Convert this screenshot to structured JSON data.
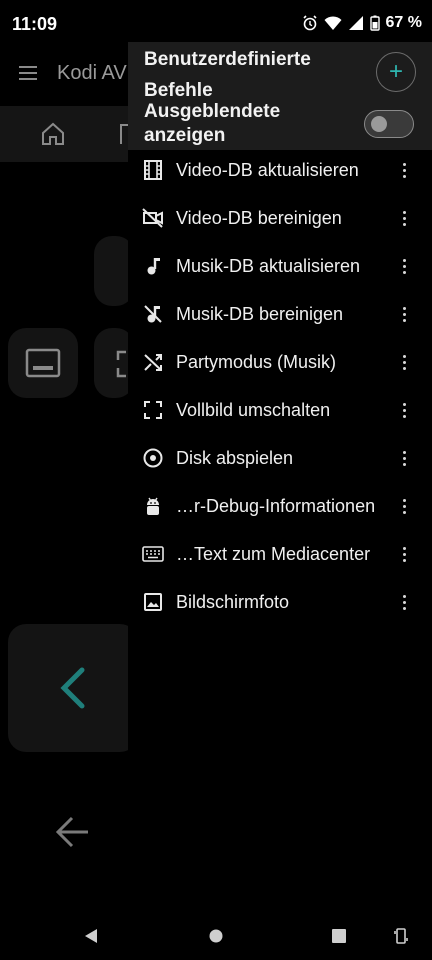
{
  "status_bar": {
    "time": "11:09",
    "battery": "67 %"
  },
  "background_app": {
    "title": "Kodi AV"
  },
  "drawer": {
    "title": "Benutzerdefinierte Befehle",
    "add_button_label": "+",
    "hidden_toggle_label": "Ausgeblendete anzeigen",
    "hidden_toggle_on": false,
    "items": [
      {
        "label": "Video-DB aktualisieren",
        "icon": "film-icon"
      },
      {
        "label": "Video-DB bereinigen",
        "icon": "video-off-icon"
      },
      {
        "label": "Musik-DB aktualisieren",
        "icon": "music-note-icon"
      },
      {
        "label": "Musik-DB bereinigen",
        "icon": "music-off-icon"
      },
      {
        "label": "Partymodus (Musik)",
        "icon": "shuffle-icon"
      },
      {
        "label": "Vollbild umschalten",
        "icon": "fullscreen-icon"
      },
      {
        "label": "Disk abspielen",
        "icon": "disc-icon"
      },
      {
        "label": "…r-Debug-Informationen",
        "icon": "android-icon"
      },
      {
        "label": "…Text zum Mediacenter",
        "icon": "keyboard-icon"
      },
      {
        "label": "Bildschirmfoto",
        "icon": "image-icon"
      }
    ]
  },
  "colors": {
    "accent": "#2fb6b0",
    "drawer_header": "#1c1c1c",
    "background": "#000000"
  }
}
